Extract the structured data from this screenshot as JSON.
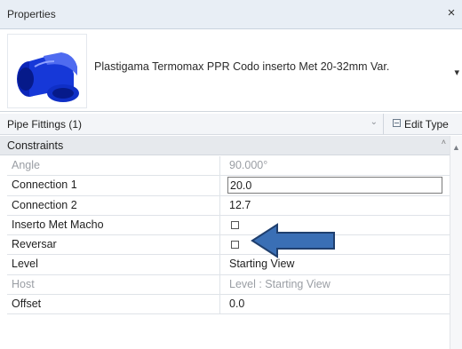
{
  "panel": {
    "title": "Properties",
    "close_glyph": "×"
  },
  "type_selector": {
    "name": "Plastigama Termomax PPR Codo inserto Met 20-32mm Var.",
    "dropdown_glyph": "▾",
    "thumbnail_icon": "pipe-elbow-fitting-icon"
  },
  "filter": {
    "label": "Pipe Fittings (1)",
    "chevron_glyph": "⌄",
    "edit_type_label": "Edit Type"
  },
  "section": {
    "label": "Constraints",
    "collapse_glyph": "˄"
  },
  "properties": [
    {
      "name": "Angle",
      "value": "90.000°",
      "disabled": true
    },
    {
      "name": "Connection 1",
      "value": "20.0",
      "editing": true
    },
    {
      "name": "Connection 2",
      "value": "12.7"
    },
    {
      "name": "Inserto Met Macho",
      "value": "",
      "checkbox": true,
      "checked": false
    },
    {
      "name": "Reversar",
      "value": "",
      "checkbox": true,
      "checked": false
    },
    {
      "name": "Level",
      "value": "Starting View"
    },
    {
      "name": "Host",
      "value": "Level : Starting View",
      "disabled": true
    },
    {
      "name": "Offset",
      "value": "0.0"
    }
  ],
  "colors": {
    "accent_blue": "#3a6fb5",
    "fitting_blue": "#1638d8"
  }
}
